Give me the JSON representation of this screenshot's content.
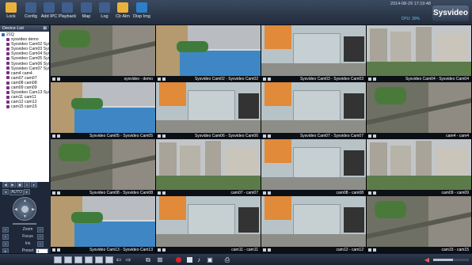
{
  "toolbar": {
    "buttons": [
      {
        "label": "Lock",
        "icon": "lock-icon",
        "color": "#e9b33b"
      },
      {
        "label": "Config",
        "icon": "config-icon",
        "color": "#3f5e8c"
      },
      {
        "label": "Add IPC",
        "icon": "add-ipc-icon",
        "color": "#3f5e8c"
      },
      {
        "label": "Playback",
        "icon": "playback-icon",
        "color": "#3f5e8c"
      },
      {
        "label": "Map",
        "icon": "map-icon",
        "color": "#3f5e8c"
      },
      {
        "label": "Log",
        "icon": "log-icon",
        "color": "#3f5e8c"
      },
      {
        "label": "Clr Alm",
        "icon": "clear-alarm-icon",
        "color": "#e9b33b"
      },
      {
        "label": "Disp Img",
        "icon": "display-image-icon",
        "color": "#2d7fc8"
      }
    ],
    "timestamp": "2014-08-29 17:19:48",
    "cpu": "CPU: 30%",
    "brand": "Sysvideo"
  },
  "device_list": {
    "title": "Device List",
    "close": "⊠",
    "root": "21Q",
    "items": [
      "sysvideo demo",
      "Sysvideo Cam02 Sysvi",
      "Sysvideo Cam03 Sysvi",
      "Sysvideo Cam04 Sysvi",
      "Sysvideo Cam05 Sysvi",
      "Sysvideo Cam06 Sysvi",
      "Sysvideo Cam07 Sysvi",
      "cam4 cam4",
      "cam07 cam07",
      "cam08 cam08",
      "cam09 cam09",
      "Sysvideo Cam13 Sysvi",
      "cam11 cam11",
      "cam12 cam12",
      "cam15 cam15"
    ]
  },
  "ptz": {
    "auto": "AUTO",
    "zoom": "Zoom",
    "focus": "Focus",
    "iris": "Iris",
    "preset": "Preset",
    "preset_value": "1"
  },
  "tiles": [
    {
      "label": "sysvideo - demo",
      "scene": "street"
    },
    {
      "label": "Sysvideo Cam02 - Sysvideo Cam02",
      "scene": "pool"
    },
    {
      "label": "Sysvideo Cam03 - Sysvideo Cam03",
      "scene": "room"
    },
    {
      "label": "Sysvideo Cam04 - Sysvideo Cam04",
      "scene": "towers"
    },
    {
      "label": "Sysvideo Cam05 - Sysvideo Cam05",
      "scene": "pool"
    },
    {
      "label": "Sysvideo Cam06 - Sysvideo Cam06",
      "scene": "room"
    },
    {
      "label": "Sysvideo Cam07 - Sysvideo Cam07",
      "scene": "room"
    },
    {
      "label": "cam4 - cam4",
      "scene": "street"
    },
    {
      "label": "Sysvideo Cam08 - Sysvideo Cam08",
      "scene": "street"
    },
    {
      "label": "cam07 - cam07",
      "scene": "towers"
    },
    {
      "label": "cam08 - cam08",
      "scene": "room"
    },
    {
      "label": "cam09 - cam09",
      "scene": "towers"
    },
    {
      "label": "Sysvideo Cam13 - Sysvideo Cam13",
      "scene": "pool"
    },
    {
      "label": "cam11 - cam11",
      "scene": "room"
    },
    {
      "label": "cam12 - cam12",
      "scene": "room"
    },
    {
      "label": "cam15 - cam15",
      "scene": "street"
    }
  ],
  "scenes": {
    "street": {
      "sky": "#c9ccc8",
      "ground": "#6e7064",
      "accent": "#4a7a3a",
      "block": "#8f8a82"
    },
    "pool": {
      "sky": "#d6d9de",
      "ground": "#3f87c4",
      "accent": "#3f7c3b",
      "block": "#b49a6e"
    },
    "room": {
      "sky": "#b8c3c7",
      "ground": "#8d8e88",
      "accent": "#e08a3a",
      "block": "#c6cfd2"
    },
    "towers": {
      "sky": "#c2c6c8",
      "ground": "#9b9a92",
      "accent": "#5b7b4a",
      "block": "#a8a49a"
    }
  },
  "bottom": {
    "volume_level": 0.55
  }
}
